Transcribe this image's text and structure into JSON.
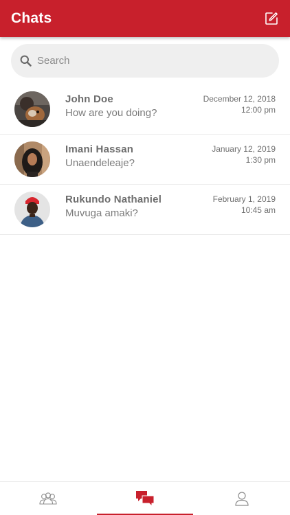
{
  "header": {
    "title": "Chats",
    "compose_icon": "compose-icon"
  },
  "search": {
    "placeholder": "Search",
    "value": ""
  },
  "chats": [
    {
      "name": "John Doe",
      "preview": "How are you doing?",
      "date": "December 12, 2018",
      "time": "12:00 pm"
    },
    {
      "name": "Imani Hassan",
      "preview": "Unaendeleaje?",
      "date": "January 12, 2019",
      "time": "1:30 pm"
    },
    {
      "name": "Rukundo Nathaniel",
      "preview": "Muvuga amaki?",
      "date": "February 1, 2019",
      "time": "10:45 am"
    }
  ],
  "tabs": [
    {
      "icon": "contacts-icon",
      "active": false
    },
    {
      "icon": "chats-icon",
      "active": true
    },
    {
      "icon": "profile-icon",
      "active": false
    }
  ],
  "colors": {
    "brand": "#c8202c",
    "search_bg": "#efefef",
    "text_secondary": "#7b7b7b"
  }
}
